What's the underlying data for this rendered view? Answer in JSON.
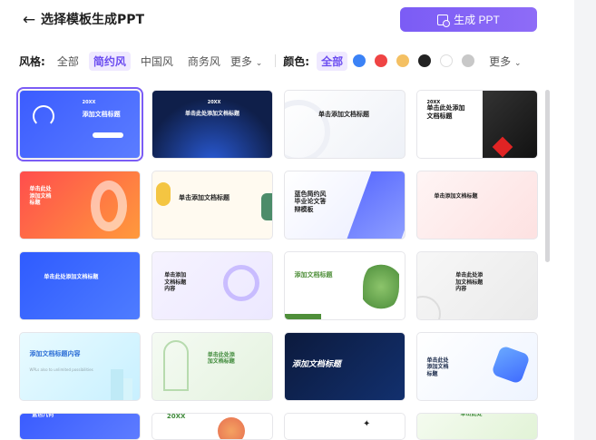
{
  "header": {
    "title": "选择模板生成PPT",
    "generate_label": "生成 PPT"
  },
  "filters": {
    "style_label": "风格:",
    "styles": [
      "全部",
      "简约风",
      "中国风",
      "商务风"
    ],
    "style_active": "简约风",
    "style_more": "更多",
    "color_label": "颜色:",
    "color_all": "全部",
    "colors": [
      "#3b82f6",
      "#ef4444",
      "#f4c063",
      "#222222",
      "#ffffff",
      "#c8c8c8"
    ],
    "color_more": "更多"
  },
  "templates": [
    {
      "title": "添加文档标题",
      "tag": "20XX",
      "theme": "blue-bulb",
      "selected": true
    },
    {
      "title": "单击此处添加文档标题",
      "tag": "20XX",
      "theme": "navy-rays"
    },
    {
      "title": "单击添加文档标题",
      "theme": "white-ring"
    },
    {
      "title": "单击此处添加文档标题",
      "tag": "20XX",
      "theme": "red-geo"
    },
    {
      "title": "单击此处添加文档标题",
      "theme": "red-swirl"
    },
    {
      "title": "单击添加文档标题",
      "theme": "yellow-green"
    },
    {
      "title": "蓝色简约风毕业论文答辩模板",
      "theme": "blue-triangle"
    },
    {
      "title": "单击添加文档标题",
      "theme": "pink-wave"
    },
    {
      "title": "单击此处添加文档标题",
      "theme": "blue-dots"
    },
    {
      "title": "单击添加文档标题内容",
      "theme": "glass-rings"
    },
    {
      "title": "添加文档标题",
      "theme": "green-leaves"
    },
    {
      "title": "单击此处添加文档标题内容",
      "theme": "grey-circles"
    },
    {
      "title": "添加文档标题内容",
      "subtitle": "WPLs also to unlimited possibilities",
      "theme": "cyan-pillar"
    },
    {
      "title": "单击此处添加文档标题",
      "theme": "green-arch"
    },
    {
      "title": "添加文档标题",
      "theme": "dark-blue-bold"
    },
    {
      "title": "单击此处添加文档标题",
      "theme": "glass-blue"
    },
    {
      "title": "蓝色几何",
      "theme": "blue-partial"
    },
    {
      "title": "20XX",
      "theme": "flower-partial"
    },
    {
      "title": "",
      "theme": "sparkle-partial"
    },
    {
      "title": "单击此处",
      "theme": "green-partial"
    }
  ]
}
